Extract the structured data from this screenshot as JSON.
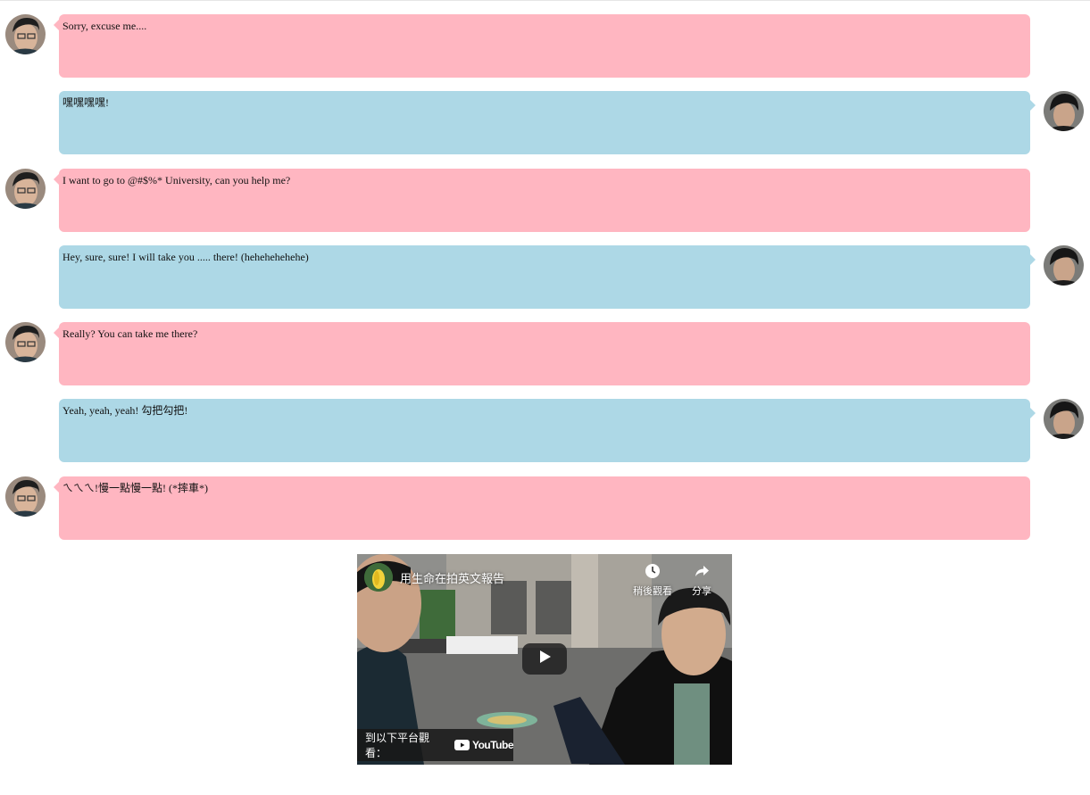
{
  "messages": [
    {
      "side": "left",
      "color": "pink",
      "text": "Sorry, excuse me...."
    },
    {
      "side": "right",
      "color": "blue",
      "text": "嘿嘿嘿嘿!"
    },
    {
      "side": "left",
      "color": "pink",
      "text": "I want to go to @#$%* University, can you help me?"
    },
    {
      "side": "right",
      "color": "blue",
      "text": "Hey, sure, sure! I will take you ..... there! (hehehehehehe)"
    },
    {
      "side": "left",
      "color": "pink",
      "text": "Really? You can take me there?"
    },
    {
      "side": "right",
      "color": "blue",
      "text": "Yeah, yeah, yeah! 勾把勾把!"
    },
    {
      "side": "left",
      "color": "pink",
      "text": "ㄟㄟㄟ!慢一點慢一點! (*摔車*)"
    }
  ],
  "video": {
    "title": "用生命在拍英文報告",
    "watch_later_label": "稍後觀看",
    "share_label": "分享",
    "watch_on_label": "到以下平台觀看：",
    "platform_label": "YouTube"
  },
  "colors": {
    "pink_bubble": "#ffb6c1",
    "blue_bubble": "#add8e6"
  }
}
